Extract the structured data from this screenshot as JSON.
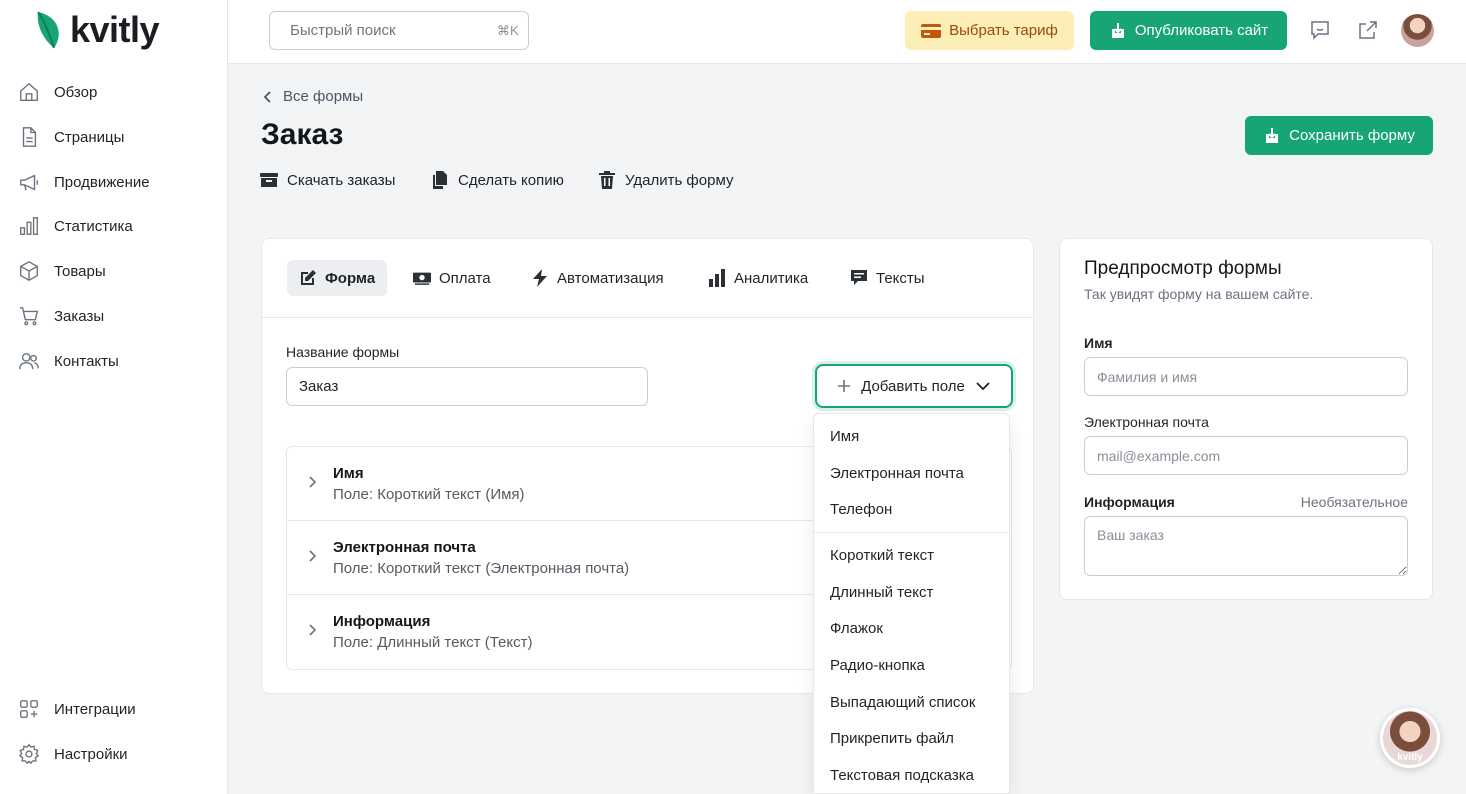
{
  "brand": {
    "name": "kvitly",
    "color": "#17a673"
  },
  "sidebar": {
    "items": [
      {
        "label": "Обзор",
        "icon": "home-icon"
      },
      {
        "label": "Страницы",
        "icon": "page-icon"
      },
      {
        "label": "Продвижение",
        "icon": "megaphone-icon"
      },
      {
        "label": "Статистика",
        "icon": "chart-icon"
      },
      {
        "label": "Товары",
        "icon": "box-icon"
      },
      {
        "label": "Заказы",
        "icon": "cart-icon"
      },
      {
        "label": "Контакты",
        "icon": "users-icon"
      }
    ],
    "bottom_items": [
      {
        "label": "Интеграции",
        "icon": "integrations-icon"
      },
      {
        "label": "Настройки",
        "icon": "gear-icon"
      }
    ]
  },
  "topbar": {
    "search_placeholder": "Быстрый поиск",
    "search_shortcut": "⌘K",
    "tariff_label": "Выбрать тариф",
    "publish_label": "Опубликовать сайт"
  },
  "page": {
    "back_label": "Все формы",
    "title": "Заказ",
    "save_label": "Сохранить форму",
    "actions": {
      "download": "Скачать заказы",
      "copy": "Сделать копию",
      "delete": "Удалить форму"
    }
  },
  "tabs": [
    {
      "label": "Форма"
    },
    {
      "label": "Оплата"
    },
    {
      "label": "Автоматизация"
    },
    {
      "label": "Аналитика"
    },
    {
      "label": "Тексты"
    }
  ],
  "form": {
    "name_label": "Название формы",
    "name_value": "Заказ",
    "add_field_label": "Добавить поле",
    "fields": [
      {
        "title": "Имя",
        "sub": "Поле: Короткий текст (Имя)"
      },
      {
        "title": "Электронная почта",
        "sub": "Поле: Короткий текст (Электронная почта)"
      },
      {
        "title": "Информация",
        "sub": "Поле: Длинный текст (Текст)"
      }
    ]
  },
  "dropdown": {
    "presets": [
      "Имя",
      "Электронная почта",
      "Телефон"
    ],
    "types": [
      "Короткий текст",
      "Длинный текст",
      "Флажок",
      "Радио-кнопка",
      "Выпадающий список",
      "Прикрепить файл",
      "Текстовая подсказка"
    ]
  },
  "preview": {
    "title": "Предпросмотр формы",
    "subtitle": "Так увидят форму на вашем сайте.",
    "name_label": "Имя",
    "name_placeholder": "Фамилия и имя",
    "email_label": "Электронная почта",
    "email_placeholder": "mail@example.com",
    "info_label": "Информация",
    "info_optional": "Необязательное",
    "info_placeholder": "Ваш заказ"
  },
  "support": {
    "label": "kvitly"
  }
}
